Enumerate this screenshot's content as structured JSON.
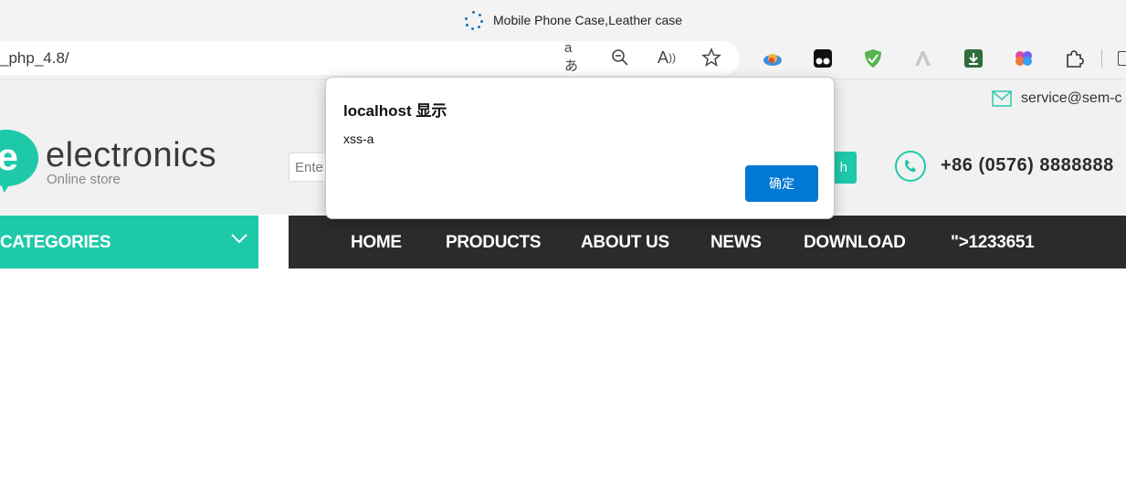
{
  "browser": {
    "tab_title": "Mobile Phone Case,Leather case",
    "url_fragment": "_php_4.8/",
    "address_icons": [
      "translate-icon",
      "zoom-out-icon",
      "read-aloud-icon",
      "favorite-star-icon"
    ],
    "extensions": [
      "weather-extension-icon",
      "tampermonkey-extension-icon",
      "adguard-shield-extension-icon",
      "ark-extension-icon",
      "download-extension-icon",
      "brain-extension-icon",
      "puzzle-extensions-icon"
    ],
    "translate_glyph": "aあ",
    "read_aloud_glyph": "A"
  },
  "site": {
    "email": "service@sem-c",
    "brand": "electronics",
    "brand_letter": "e",
    "brand_sub": "Online store",
    "search_placeholder": "Ente",
    "search_button": "h",
    "phone": "+86 (0576) 8888888",
    "categories_label": "CATEGORIES",
    "nav": [
      "HOME",
      "PRODUCTS",
      "ABOUT US",
      "NEWS",
      "DOWNLOAD",
      "\">1233651"
    ],
    "accent": "#1ec9aa",
    "nav_bg": "#2b2b2b"
  },
  "dialog": {
    "title": "localhost 显示",
    "message": "xss-a",
    "ok_label": "确定",
    "button_color": "#0078d4"
  }
}
